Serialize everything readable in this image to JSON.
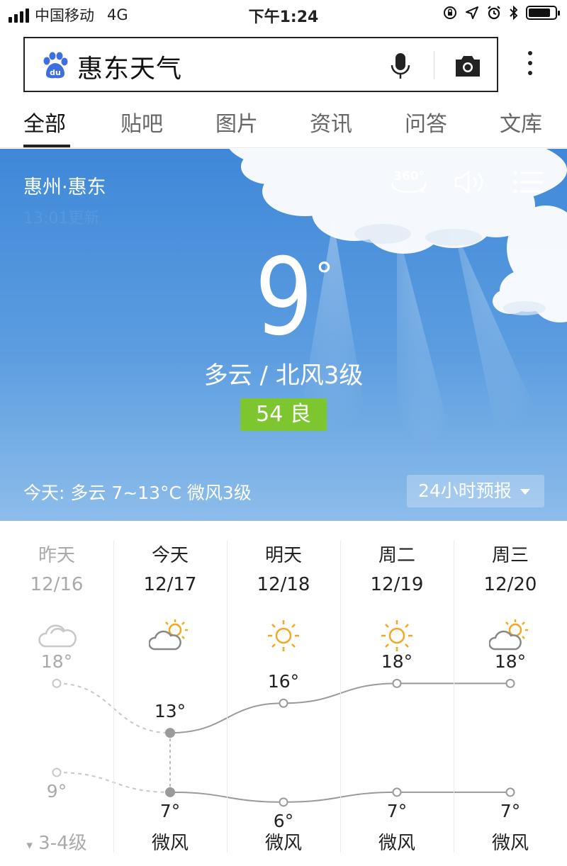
{
  "status_bar": {
    "carrier": "中国移动",
    "network": "4G",
    "time": "下午1:24"
  },
  "search": {
    "query": "惠东天气"
  },
  "tabs": [
    "全部",
    "贴吧",
    "图片",
    "资讯",
    "问答",
    "文库"
  ],
  "weather": {
    "location": "惠州·惠东",
    "update": "13:01更新",
    "icon_360": "360°",
    "temperature": "9",
    "degree": "°",
    "condition": "多云  /  北风3级",
    "aqi": "54 良",
    "aqi_color": "#7ec630",
    "today": "今天:  多云   7~13°C   微风3级",
    "forecast_button": "24小时预报"
  },
  "days": [
    {
      "name": "昨天",
      "date": "12/16",
      "icon": "cloud-icon",
      "high": "18°",
      "low": "9°",
      "wind": "3-4级",
      "past": true
    },
    {
      "name": "今天",
      "date": "12/17",
      "icon": "partly-sunny-icon",
      "high": "13°",
      "low": "7°",
      "wind": "微风"
    },
    {
      "name": "明天",
      "date": "12/18",
      "icon": "sun-icon",
      "high": "16°",
      "low": "6°",
      "wind": "微风"
    },
    {
      "name": "周二",
      "date": "12/19",
      "icon": "sun-icon",
      "high": "18°",
      "low": "7°",
      "wind": "微风"
    },
    {
      "name": "周三",
      "date": "12/20",
      "icon": "partly-sunny-icon",
      "high": "18°",
      "low": "7°",
      "wind": "微风"
    }
  ],
  "chart_data": {
    "type": "line",
    "categories": [
      "12/16",
      "12/17",
      "12/18",
      "12/19",
      "12/20"
    ],
    "series": [
      {
        "values": [
          18,
          13,
          16,
          18,
          18
        ]
      },
      {
        "values": [
          9,
          7,
          6,
          7,
          7
        ]
      }
    ]
  }
}
